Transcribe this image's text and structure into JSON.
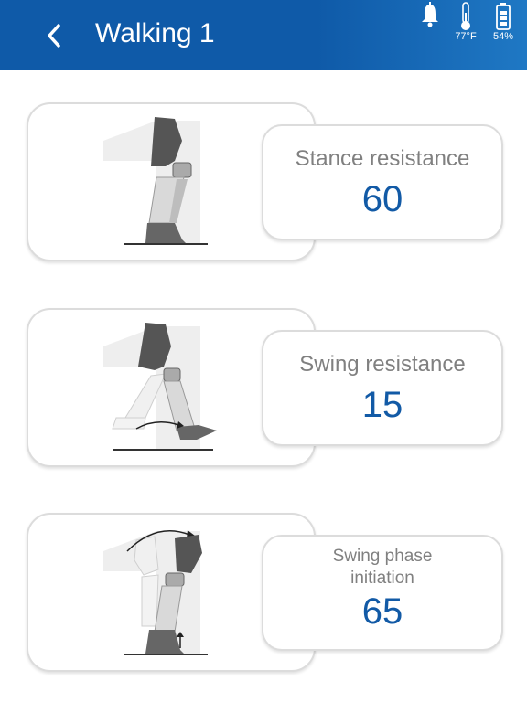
{
  "header": {
    "title": "Walking 1",
    "temperature": "77°F",
    "battery": "54%"
  },
  "settings": [
    {
      "label": "Stance resistance",
      "value": "60"
    },
    {
      "label": "Swing resistance",
      "value": "15"
    },
    {
      "label_line1": "Swing phase",
      "label_line2": "initiation",
      "value": "65"
    }
  ],
  "colors": {
    "header": "#0f5aa8",
    "value": "#125aa6",
    "label": "#808080"
  }
}
